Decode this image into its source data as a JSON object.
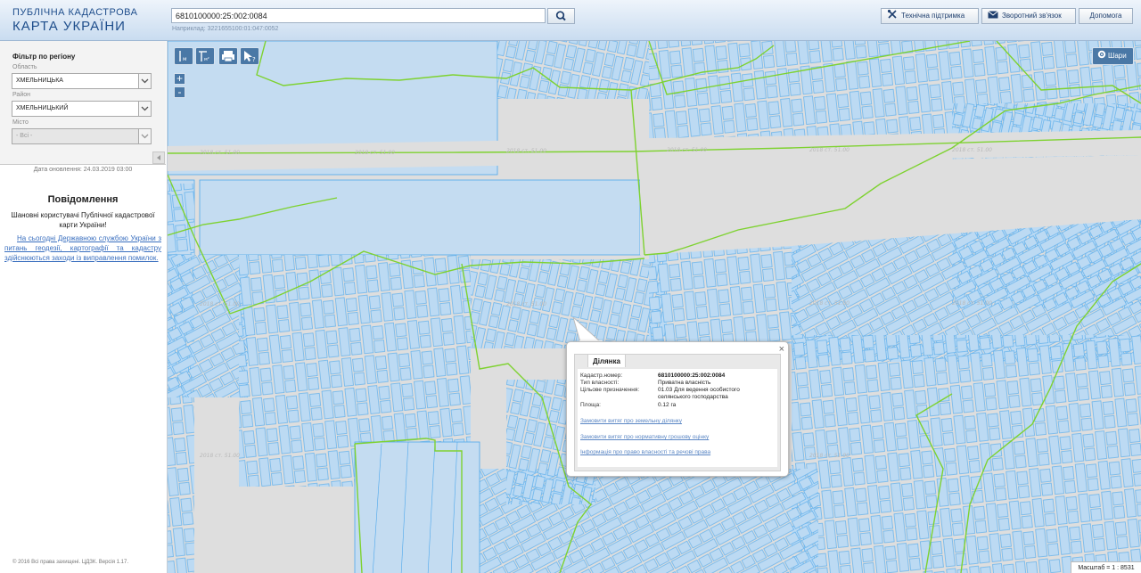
{
  "header": {
    "logo_line1": "ПУБЛІЧНА КАДАСТРОВА",
    "logo_line2": "КАРТА УКРАЇНИ",
    "search_value": "6810100000:25:002:0084",
    "search_hint": "Наприклад: 3221655100:01:047:0052",
    "buttons": {
      "support": "Технічна підтримка",
      "feedback": "Зворотний зв'язок",
      "help": "Допомога"
    }
  },
  "sidebar": {
    "filter_title": "Фільтр по регіону",
    "oblast_label": "Область",
    "oblast_value": "ХМЕЛЬНИЦЬКА",
    "raion_label": "Район",
    "raion_value": "ХМЕЛЬНИЦЬКИЙ",
    "misto_label": "Місто",
    "misto_value": "- Всі -",
    "update_date": "Дата оновлення: 24.03.2019 03:00",
    "notice_title": "Повідомлення",
    "notice_text": "Шановні користувачі Публічної кадастрової карти України!",
    "notice_link": "На сьогодні Державною службою України з питань геодезії, картографії та кадастру здійснюються заходи із виправлення помилок.",
    "copyright": "© 2016 Всі права захищені. ЦДЗК. Версія 1.17."
  },
  "map": {
    "toolbar": {
      "measure_line": "м",
      "measure_area": "м²"
    },
    "zoom_in": "+",
    "zoom_out": "-",
    "layers_label": "Шари",
    "scale_text": "Масштаб = 1 : 8531",
    "watermark": "2018 ст. 51.00"
  },
  "popup": {
    "tab": "Ділянка",
    "rows": [
      {
        "key": "Кадастр.номер:",
        "value": "6810100000:25:002:0084"
      },
      {
        "key": "Тип власності:",
        "value": "Приватна власність"
      },
      {
        "key": "Цільове призначення:",
        "value": "01.03 Для ведення особистого селянського господарства"
      },
      {
        "key": "Площа:",
        "value": "0.12 га"
      }
    ],
    "links": [
      "Замовити витяг про земельну ділянку",
      "Замовити витяг про нормативну грошову оцінку",
      "Інформація про право власності та речові права"
    ]
  },
  "colors": {
    "parcel_fill": "#bcdaf3",
    "parcel_stroke": "#4ea8ec",
    "boundary_green": "#7ed230",
    "map_bg": "#dedede"
  }
}
